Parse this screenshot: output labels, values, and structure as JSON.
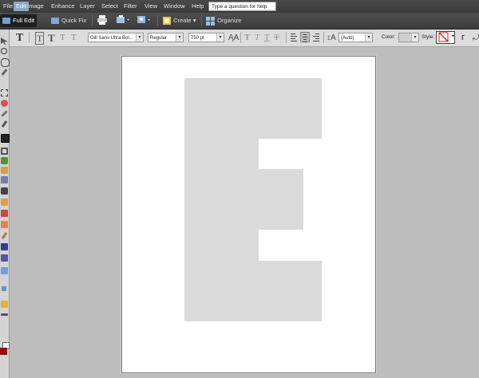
{
  "menu": {
    "items": [
      "File",
      "Edit",
      "Image",
      "Enhance",
      "Layer",
      "Select",
      "Filter",
      "View",
      "Window",
      "Help"
    ],
    "active_index": 1,
    "help_placeholder": "Type a question for help"
  },
  "modes": {
    "full_edit": "Full Edit",
    "quick_fix": "Quick Fix",
    "create": "Create",
    "organize": "Organize"
  },
  "options": {
    "tool_glyph": "T",
    "style_glyphs": [
      "T",
      "T",
      "T",
      "T"
    ],
    "font_family": "Gill Sans Ultra Bol...",
    "font_style": "Regular",
    "font_size": "750 pt",
    "text_style_glyphs": [
      "T",
      "T",
      "T",
      "T"
    ],
    "leading": "(Auto)",
    "color_label": "Color:",
    "style_label": "Style:",
    "colors": {
      "accent_red": "#cc2222"
    }
  },
  "document": {
    "letter_color": "#dadada",
    "icons": [
      "move-tool-icon",
      "zoom-tool-icon",
      "lasso-tool-icon",
      "eyedropper-tool-icon",
      "marquee-tool-icon",
      "quick-selection-icon",
      "magic-wand-icon",
      "brush-icon",
      "type-tool-icon",
      "crop-tool-icon",
      "cookie-cutter-icon",
      "red-eye-icon",
      "spot-healing-icon",
      "clone-stamp-icon",
      "eraser-icon",
      "pencil-icon",
      "paint-bucket-icon",
      "gradient-tool-icon",
      "shape-tool-icon",
      "sponge-tool-icon",
      "blur-tool-icon",
      "smudge-tool-icon",
      "hand-tool-icon",
      "default-colors-icon"
    ]
  }
}
